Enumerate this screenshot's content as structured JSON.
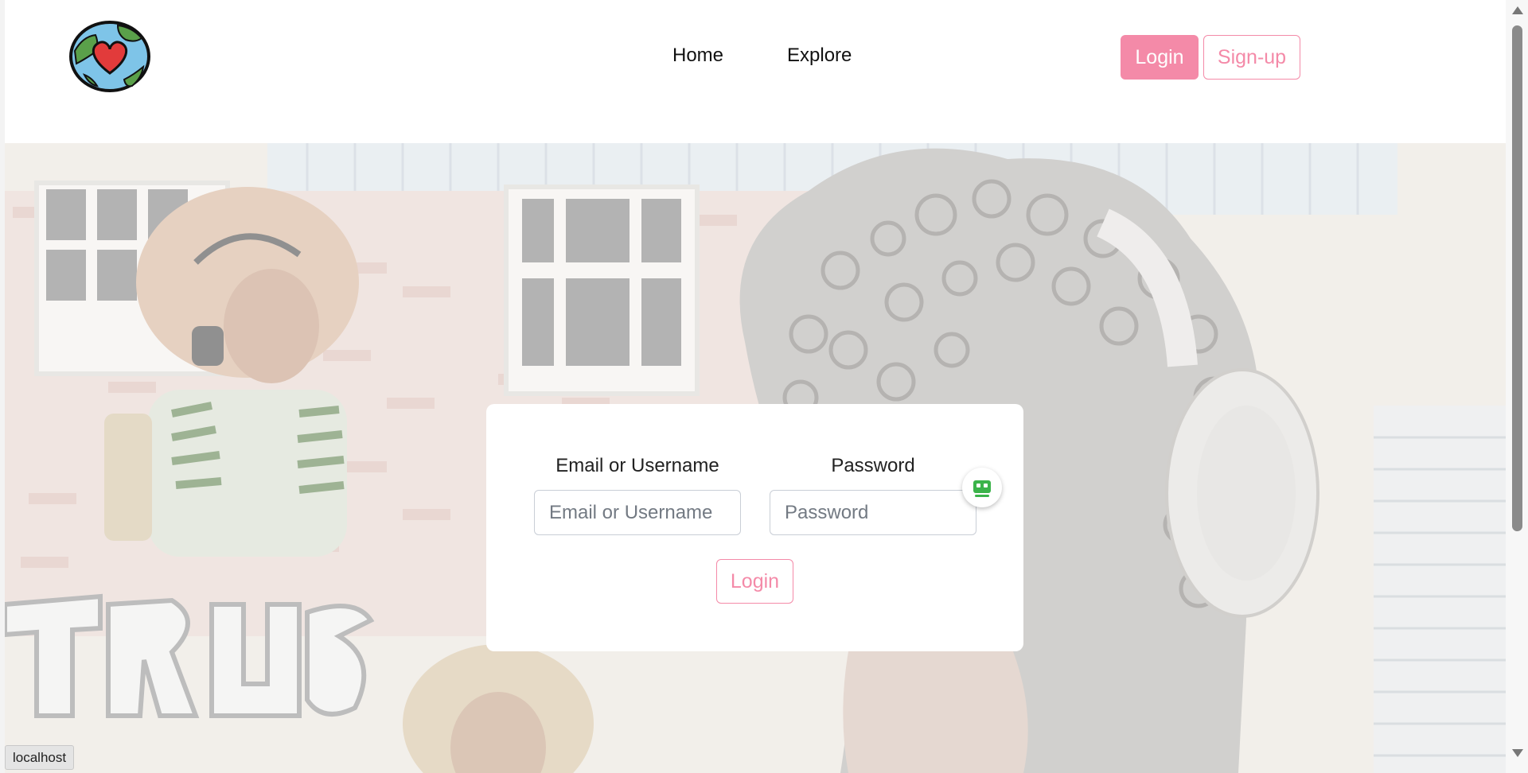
{
  "header": {
    "nav": [
      {
        "label": "Home"
      },
      {
        "label": "Explore"
      }
    ],
    "login_button": "Login",
    "signup_button": "Sign-up"
  },
  "login_card": {
    "email_label": "Email or Username",
    "email_placeholder": "Email or Username",
    "password_label": "Password",
    "password_placeholder": "Password",
    "submit_button": "Login"
  },
  "status_bar": {
    "url": "localhost"
  },
  "colors": {
    "accent": "#f48aa8",
    "logo_globe": "#7ec4e8",
    "logo_land": "#5aa04a",
    "logo_heart": "#e23b3b",
    "extension_icon": "#3bb34a"
  },
  "icons": {
    "logo": "globe-heart-logo",
    "extension": "password-manager-robot-icon"
  }
}
